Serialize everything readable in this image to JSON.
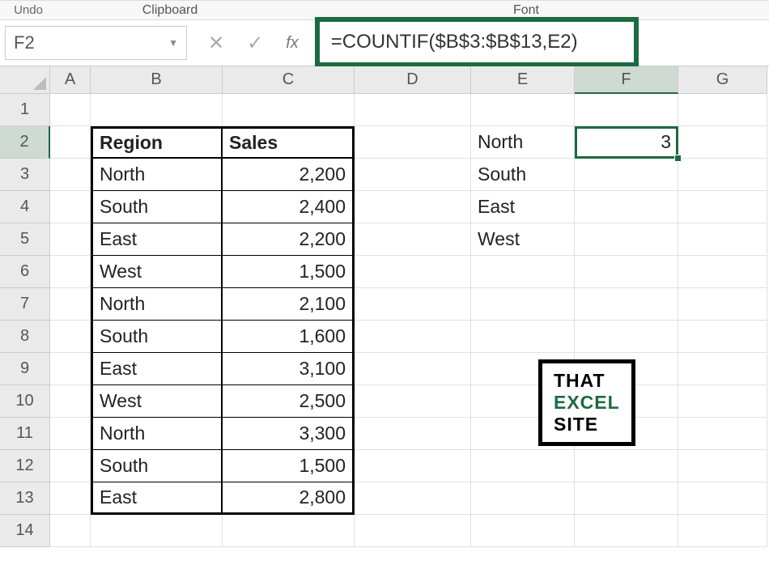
{
  "ribbon": {
    "undo": "Undo",
    "clipboard": "Clipboard",
    "font": "Font"
  },
  "namebox": "F2",
  "formula": "=COUNTIF($B$3:$B$13,E2)",
  "fx": "fx",
  "cols": {
    "A": "A",
    "B": "B",
    "C": "C",
    "D": "D",
    "E": "E",
    "F": "F",
    "G": "G"
  },
  "rows": {
    "1": "1",
    "2": "2",
    "3": "3",
    "4": "4",
    "5": "5",
    "6": "6",
    "7": "7",
    "8": "8",
    "9": "9",
    "10": "10",
    "11": "11",
    "12": "12",
    "13": "13",
    "14": "14"
  },
  "headers": {
    "region": "Region",
    "sales": "Sales"
  },
  "table": [
    {
      "region": "North",
      "sales": "2,200"
    },
    {
      "region": "South",
      "sales": "2,400"
    },
    {
      "region": "East",
      "sales": "2,200"
    },
    {
      "region": "West",
      "sales": "1,500"
    },
    {
      "region": "North",
      "sales": "2,100"
    },
    {
      "region": "South",
      "sales": "1,600"
    },
    {
      "region": "East",
      "sales": "3,100"
    },
    {
      "region": "West",
      "sales": "2,500"
    },
    {
      "region": "North",
      "sales": "3,300"
    },
    {
      "region": "South",
      "sales": "1,500"
    },
    {
      "region": "East",
      "sales": "2,800"
    }
  ],
  "criteria": [
    "North",
    "South",
    "East",
    "West"
  ],
  "result_F2": "3",
  "logo": {
    "l1": "THAT",
    "l2": "EXCEL",
    "l3": "SITE"
  },
  "chart_data": {
    "type": "table",
    "title": "",
    "columns": [
      "Region",
      "Sales"
    ],
    "rows": [
      [
        "North",
        2200
      ],
      [
        "South",
        2400
      ],
      [
        "East",
        2200
      ],
      [
        "West",
        1500
      ],
      [
        "North",
        2100
      ],
      [
        "South",
        1600
      ],
      [
        "East",
        3100
      ],
      [
        "West",
        2500
      ],
      [
        "North",
        3300
      ],
      [
        "South",
        1500
      ],
      [
        "East",
        2800
      ]
    ]
  }
}
